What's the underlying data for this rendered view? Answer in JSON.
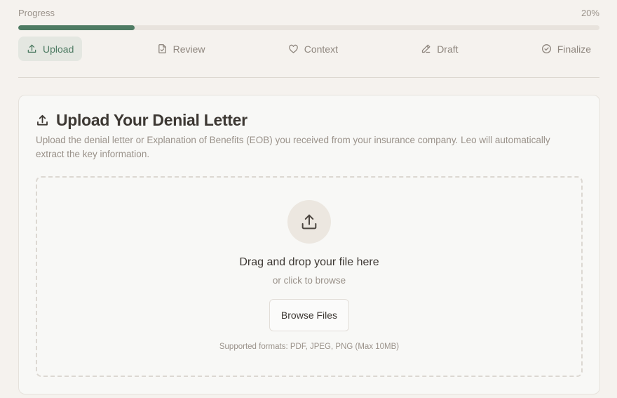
{
  "progress": {
    "label": "Progress",
    "percent_text": "20%",
    "fraction": 0.2,
    "color": "#4e7b63"
  },
  "steps": [
    {
      "label": "Upload",
      "icon": "upload-icon",
      "active": true
    },
    {
      "label": "Review",
      "icon": "document-check-icon",
      "active": false
    },
    {
      "label": "Context",
      "icon": "heart-icon",
      "active": false
    },
    {
      "label": "Draft",
      "icon": "pencil-icon",
      "active": false
    },
    {
      "label": "Finalize",
      "icon": "check-circle-icon",
      "active": false
    }
  ],
  "upload_card": {
    "title": "Upload Your Denial Letter",
    "title_icon": "upload-icon",
    "description": "Upload the denial letter or Explanation of Benefits (EOB) you received from your insurance company. Leo will automatically extract the key information.",
    "dropzone": {
      "icon": "upload-icon",
      "title": "Drag and drop your file here",
      "subtitle": "or click to browse",
      "button_label": "Browse Files",
      "formats": "Supported formats: PDF, JPEG, PNG (Max 10MB)"
    }
  },
  "colors": {
    "background": "#f5f2ee",
    "accent": "#4e7b63",
    "active_step_bg": "#e4e7e1",
    "muted_text": "#9a928a"
  }
}
